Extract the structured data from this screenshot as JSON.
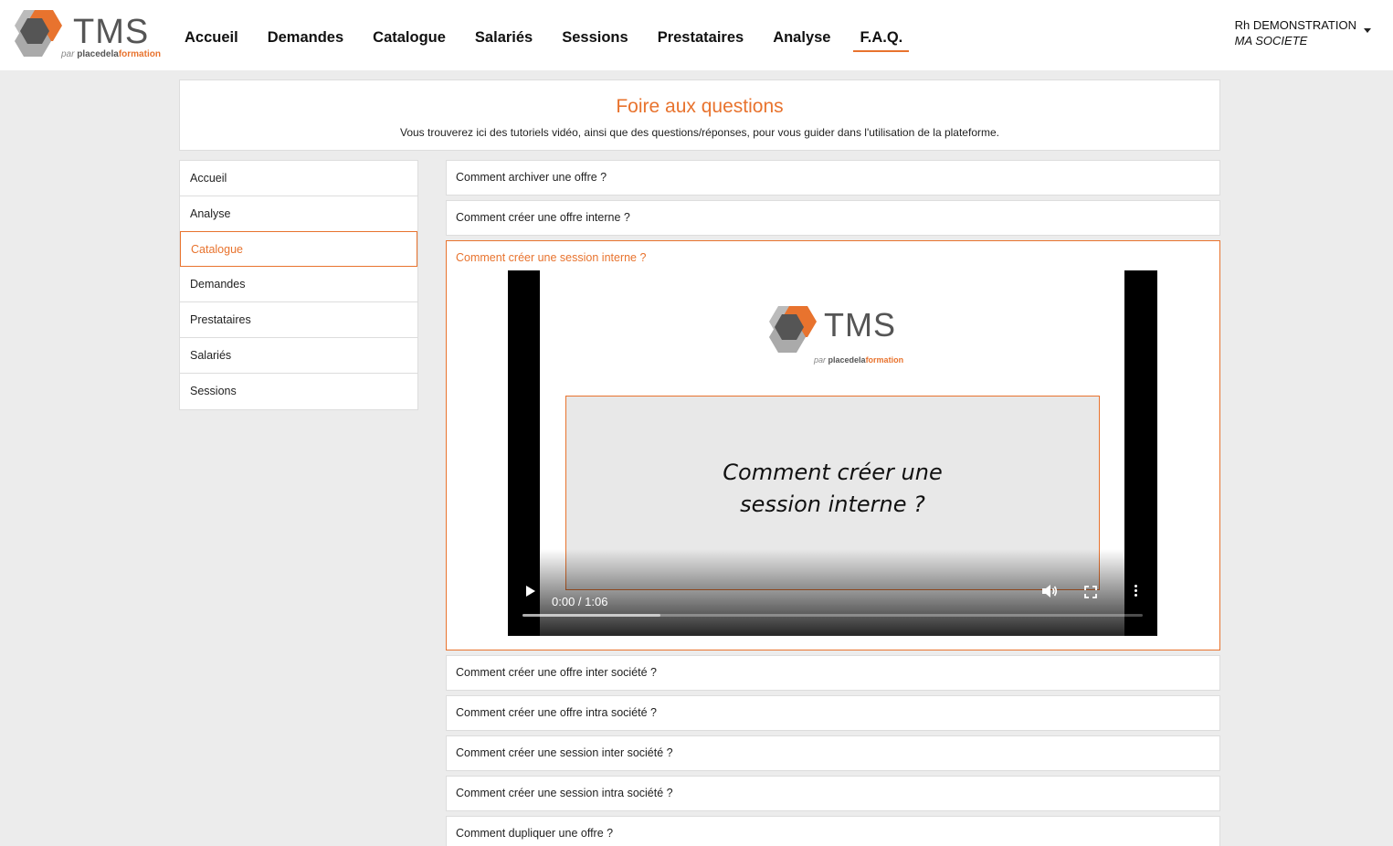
{
  "header": {
    "logo": {
      "text": "TMS",
      "sub_prefix": "par",
      "sub_brand_a": "placedela",
      "sub_brand_b": "formation"
    },
    "nav": [
      {
        "label": "Accueil",
        "active": false
      },
      {
        "label": "Demandes",
        "active": false
      },
      {
        "label": "Catalogue",
        "active": false
      },
      {
        "label": "Salariés",
        "active": false
      },
      {
        "label": "Sessions",
        "active": false
      },
      {
        "label": "Prestataires",
        "active": false
      },
      {
        "label": "Analyse",
        "active": false
      },
      {
        "label": "F.A.Q.",
        "active": true
      }
    ],
    "user": {
      "name": "Rh DEMONSTRATION",
      "company": "MA SOCIETE"
    }
  },
  "page": {
    "title": "Foire aux questions",
    "subtitle": "Vous trouverez ici des tutoriels vidéo, ainsi que des questions/réponses, pour vous guider dans l'utilisation de la plateforme."
  },
  "sidebar": {
    "items": [
      {
        "label": "Accueil",
        "active": false
      },
      {
        "label": "Analyse",
        "active": false
      },
      {
        "label": "Catalogue",
        "active": true
      },
      {
        "label": "Demandes",
        "active": false
      },
      {
        "label": "Prestataires",
        "active": false
      },
      {
        "label": "Salariés",
        "active": false
      },
      {
        "label": "Sessions",
        "active": false
      }
    ]
  },
  "faq": {
    "items": [
      {
        "question": "Comment archiver une offre ?"
      },
      {
        "question": "Comment créer une offre interne ?"
      },
      {
        "question": "Comment créer une session interne ?",
        "open": true
      },
      {
        "question": "Comment créer une offre inter société ?"
      },
      {
        "question": "Comment créer une offre intra société ?"
      },
      {
        "question": "Comment créer une session inter société ?"
      },
      {
        "question": "Comment créer une session intra société ?"
      },
      {
        "question": "Comment dupliquer une offre ?"
      }
    ]
  },
  "video": {
    "logo_text": "TMS",
    "logo_sub_prefix": "par",
    "logo_sub_brand_a": "placedela",
    "logo_sub_brand_b": "formation",
    "slide_text": "Comment créer une session interne ?",
    "time": "0:00 / 1:06",
    "buffered_fraction": 0.222
  },
  "colors": {
    "accent": "#e8732e",
    "background": "#ececec"
  }
}
